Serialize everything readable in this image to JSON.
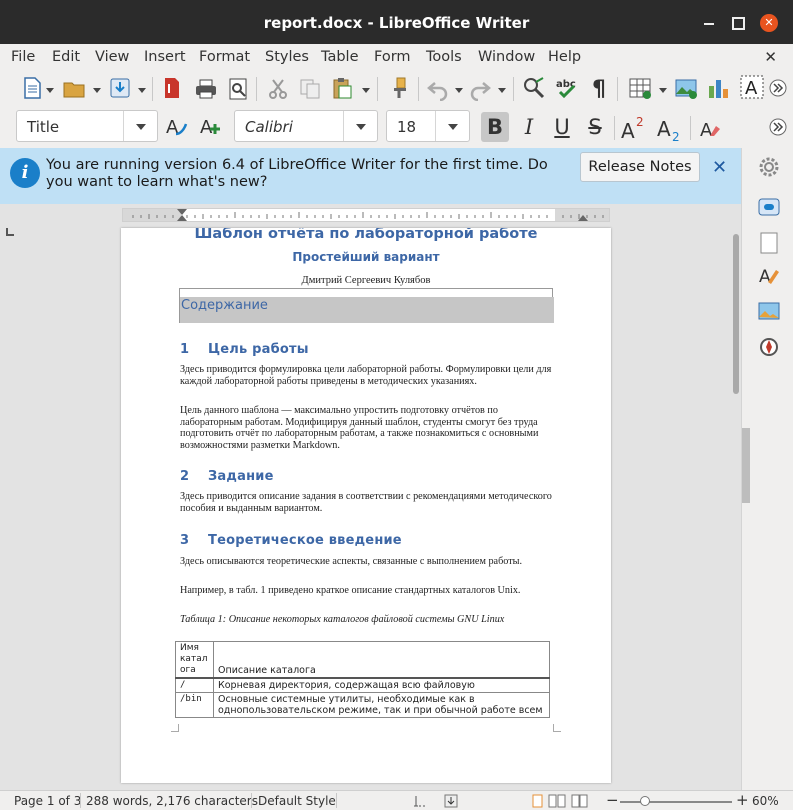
{
  "window": {
    "title": "report.docx - LibreOffice Writer"
  },
  "menubar": {
    "items": [
      "File",
      "Edit",
      "View",
      "Insert",
      "Format",
      "Styles",
      "Table",
      "Form",
      "Tools",
      "Window",
      "Help"
    ]
  },
  "formatting": {
    "paragraph_style": "Title",
    "font_name": "Calibri",
    "font_size": "18"
  },
  "infobar": {
    "message": "You are running version 6.4 of LibreOffice Writer for the first time. Do you want to learn what's new?",
    "button_label": "Release Notes"
  },
  "document": {
    "title": "Шаблон отчёта по лабораторной работе",
    "subtitle": "Простейший вариант",
    "author": "Дмитрий Сергеевич Кулябов",
    "toc_heading": "Содержание",
    "sections": [
      {
        "number": "1",
        "heading": "Цель работы",
        "paragraphs": [
          "Здесь приводится формулировка цели лабораторной работы. Формулировки цели для каждой лабораторной работы приведены в методических указаниях.",
          "Цель данного шаблона — максимально упростить подготовку отчётов по лабораторным работам. Модифицируя данный шаблон, студенты смогут без труда подготовить отчёт по лабораторным работам, а также познакомиться с основными возможностями разметки Markdown."
        ]
      },
      {
        "number": "2",
        "heading": "Задание",
        "paragraphs": [
          "Здесь приводится описание задания в соответствии с рекомендациями методического пособия и выданным вариантом."
        ]
      },
      {
        "number": "3",
        "heading": "Теоретическое введение",
        "paragraphs": [
          "Здесь описываются теоретические аспекты, связанные с выполнением работы.",
          "Например, в табл. 1 приведено краткое описание стандартных каталогов Unix."
        ]
      }
    ],
    "table": {
      "caption": "Таблица 1: Описание некоторых каталогов файловой системы GNU Linux",
      "header": [
        "Имя катал ога",
        "Описание каталога"
      ],
      "rows": [
        [
          "/",
          "Корневая директория, содержащая всю файловую"
        ],
        [
          "/bin",
          "Основные системные утилиты, необходимые как в однопользовательском режиме, так и при обычной работе всем"
        ]
      ]
    }
  },
  "statusbar": {
    "page": "Page 1 of 3",
    "counts": "288 words, 2,176 characters",
    "page_style": "Default Style",
    "zoom": "60%"
  }
}
